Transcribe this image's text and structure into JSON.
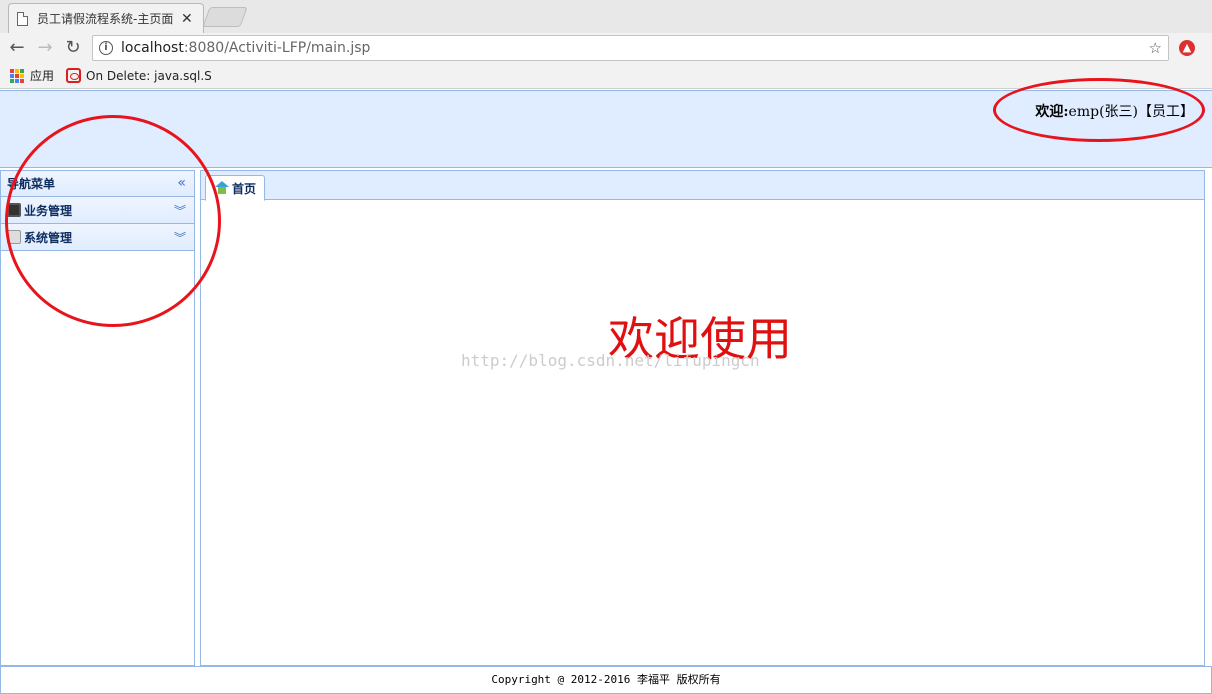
{
  "browser": {
    "tab_title": "员工请假流程系统-主页面",
    "tab_close": "✕",
    "url_host": "localhost",
    "url_rest": ":8080/Activiti-LFP/main.jsp",
    "bookmarks": [
      {
        "label": "应用"
      },
      {
        "label": "On Delete: java.sql.S"
      }
    ]
  },
  "header": {
    "welcome_label": "欢迎:",
    "welcome_user": "emp(张三)【员工】"
  },
  "west": {
    "title": "导航菜单",
    "items": [
      {
        "label": "业务管理"
      },
      {
        "label": "系统管理"
      }
    ]
  },
  "center": {
    "tabs": [
      {
        "label": "首页"
      }
    ],
    "welcome_text": "欢迎使用",
    "watermark": "http://blog.csdn.net/lifupingcn"
  },
  "footer": {
    "copyright": "Copyright @ 2012-2016 李福平 版权所有"
  },
  "colors": {
    "panel_bg": "#e0ecff",
    "panel_border": "#95b8e7",
    "welcome_red": "#e01010",
    "annotation_red": "#e8141c"
  }
}
